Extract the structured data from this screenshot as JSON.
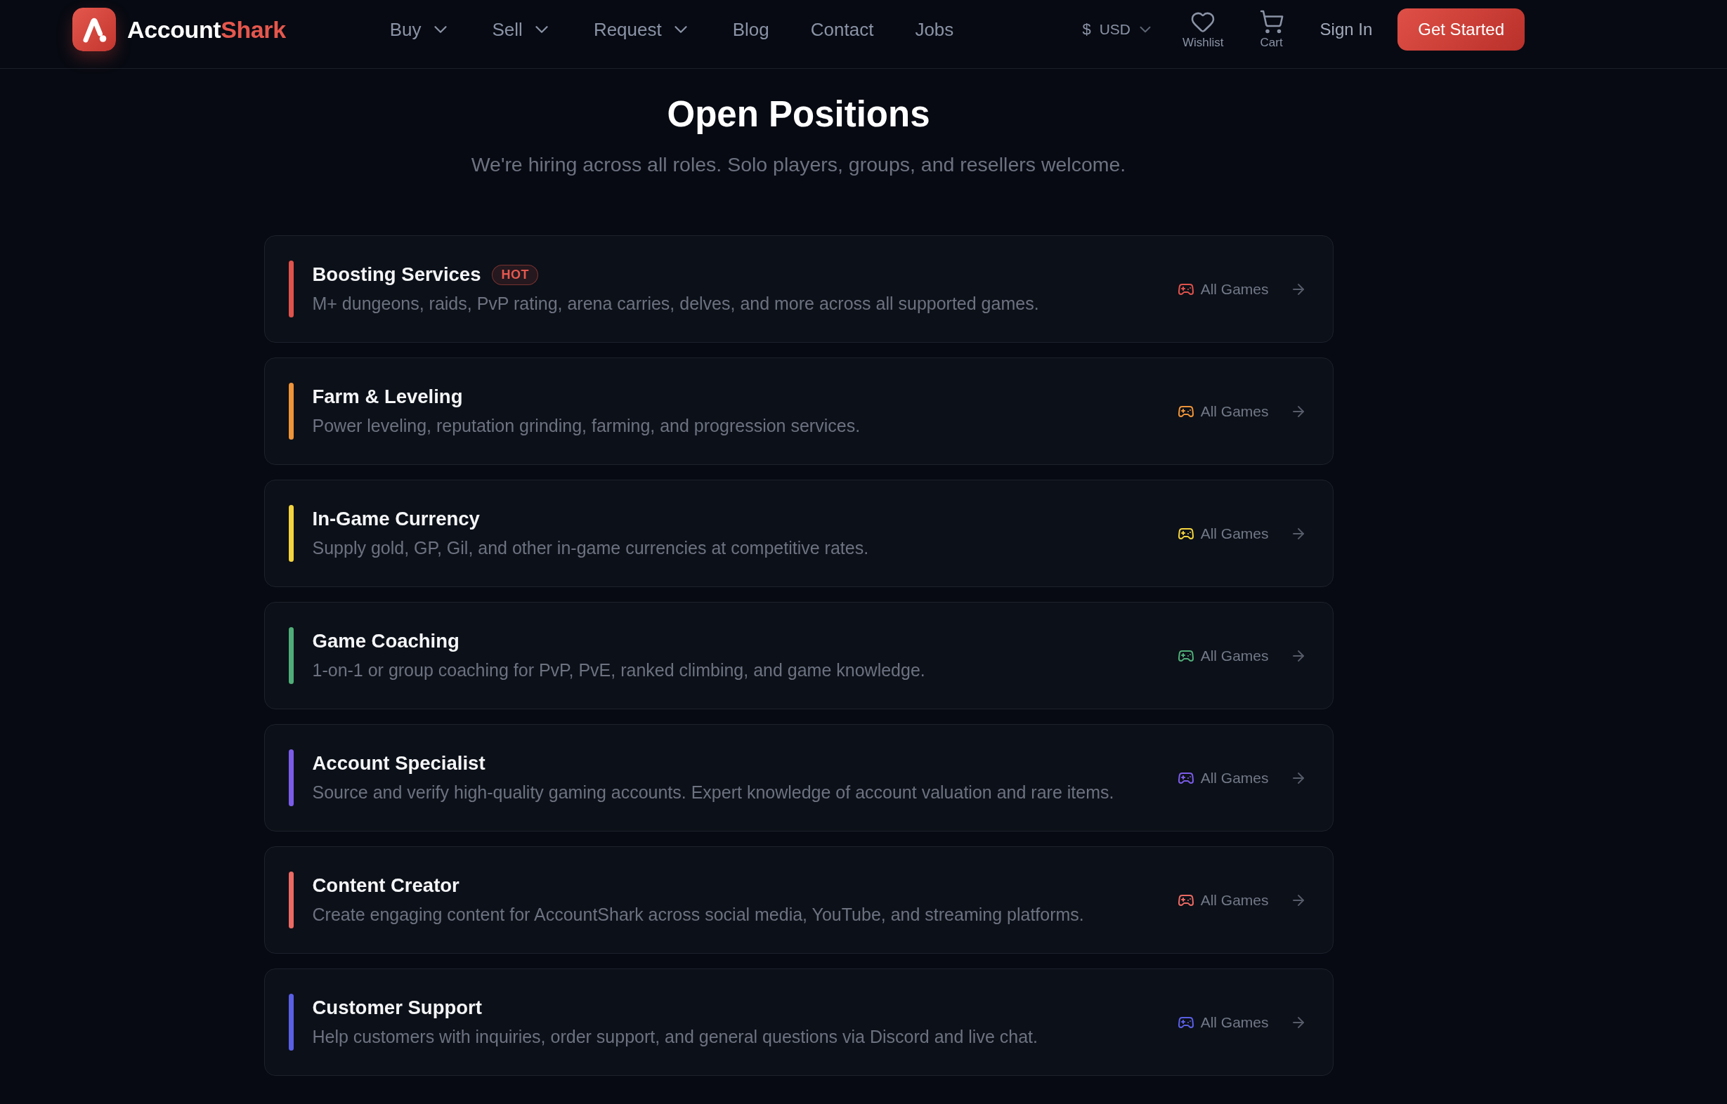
{
  "header": {
    "brand": {
      "name": "Account",
      "name_accent": "Shark"
    },
    "nav": [
      {
        "label": "Buy",
        "has_menu": true
      },
      {
        "label": "Sell",
        "has_menu": true
      },
      {
        "label": "Request",
        "has_menu": true
      },
      {
        "label": "Blog",
        "has_menu": false
      },
      {
        "label": "Contact",
        "has_menu": false
      },
      {
        "label": "Jobs",
        "has_menu": false
      }
    ],
    "currency": {
      "symbol": "$",
      "code": "USD"
    },
    "wishlist": {
      "label": "Wishlist"
    },
    "cart": {
      "label": "Cart"
    },
    "sign_in": "Sign In",
    "cta": "Get Started"
  },
  "hero": {
    "title": "Open Positions",
    "subtitle": "We're hiring across all roles. Solo players, groups, and resellers welcome."
  },
  "positions": [
    {
      "title": "Boosting Services",
      "badge": "HOT",
      "description": "M+ dungeons, raids, PvP rating, arena carries, delves, and more across all supported games.",
      "games": "All Games",
      "color": "#e0524c"
    },
    {
      "title": "Farm & Leveling",
      "description": "Power leveling, reputation grinding, farming, and progression services.",
      "games": "All Games",
      "color": "#ee9439"
    },
    {
      "title": "In-Game Currency",
      "description": "Supply gold, GP, Gil, and other in-game currencies at competitive rates.",
      "games": "All Games",
      "color": "#f4d43e"
    },
    {
      "title": "Game Coaching",
      "description": "1-on-1 or group coaching for PvP, PvE, ranked climbing, and game knowledge.",
      "games": "All Games",
      "color": "#4fae78"
    },
    {
      "title": "Account Specialist",
      "description": "Source and verify high-quality gaming accounts. Expert knowledge of account valuation and rare items.",
      "games": "All Games",
      "color": "#7b5ce9"
    },
    {
      "title": "Content Creator",
      "description": "Create engaging content for AccountShark across social media, YouTube, and streaming platforms.",
      "games": "All Games",
      "color": "#ec6a63"
    },
    {
      "title": "Customer Support",
      "description": "Help customers with inquiries, order support, and general questions via Discord and live chat.",
      "games": "All Games",
      "color": "#5a5fe5"
    }
  ]
}
